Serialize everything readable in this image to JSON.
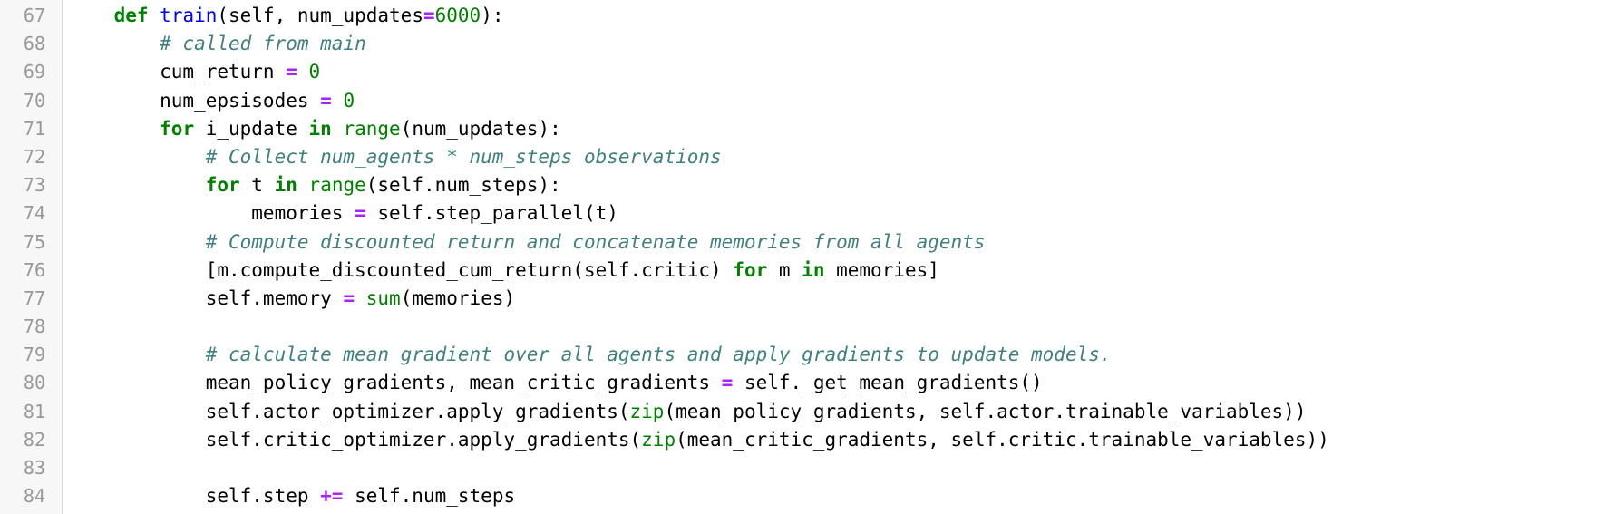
{
  "editor": {
    "lines": [
      {
        "n": "67",
        "t": [
          [
            "",
            "    "
          ],
          [
            "kw",
            "def"
          ],
          [
            "",
            " "
          ],
          [
            "fn",
            "train"
          ],
          [
            "",
            "(self, num_updates"
          ],
          [
            "op",
            "="
          ],
          [
            "num",
            "6000"
          ],
          [
            "",
            "):"
          ]
        ]
      },
      {
        "n": "68",
        "t": [
          [
            "",
            "        "
          ],
          [
            "cm",
            "# called from main"
          ]
        ]
      },
      {
        "n": "69",
        "t": [
          [
            "",
            "        cum_return "
          ],
          [
            "op",
            "="
          ],
          [
            "",
            " "
          ],
          [
            "num",
            "0"
          ]
        ]
      },
      {
        "n": "70",
        "t": [
          [
            "",
            "        num_epsisodes "
          ],
          [
            "op",
            "="
          ],
          [
            "",
            " "
          ],
          [
            "num",
            "0"
          ]
        ]
      },
      {
        "n": "71",
        "t": [
          [
            "",
            "        "
          ],
          [
            "kw",
            "for"
          ],
          [
            "",
            " i_update "
          ],
          [
            "kw",
            "in"
          ],
          [
            "",
            " "
          ],
          [
            "bi",
            "range"
          ],
          [
            "",
            "(num_updates):"
          ]
        ]
      },
      {
        "n": "72",
        "t": [
          [
            "",
            "            "
          ],
          [
            "cm",
            "# Collect num_agents * num_steps observations"
          ]
        ]
      },
      {
        "n": "73",
        "t": [
          [
            "",
            "            "
          ],
          [
            "kw",
            "for"
          ],
          [
            "",
            " t "
          ],
          [
            "kw",
            "in"
          ],
          [
            "",
            " "
          ],
          [
            "bi",
            "range"
          ],
          [
            "",
            "(self.num_steps):"
          ]
        ]
      },
      {
        "n": "74",
        "t": [
          [
            "",
            "                memories "
          ],
          [
            "op",
            "="
          ],
          [
            "",
            " self.step_parallel(t)"
          ]
        ]
      },
      {
        "n": "75",
        "t": [
          [
            "",
            "            "
          ],
          [
            "cm",
            "# Compute discounted return and concatenate memories from all agents"
          ]
        ]
      },
      {
        "n": "76",
        "t": [
          [
            "",
            "            [m.compute_discounted_cum_return(self.critic) "
          ],
          [
            "kw",
            "for"
          ],
          [
            "",
            " m "
          ],
          [
            "kw",
            "in"
          ],
          [
            "",
            " memories]"
          ]
        ]
      },
      {
        "n": "77",
        "t": [
          [
            "",
            "            self.memory "
          ],
          [
            "op",
            "="
          ],
          [
            "",
            " "
          ],
          [
            "bi",
            "sum"
          ],
          [
            "",
            "(memories)"
          ]
        ]
      },
      {
        "n": "78",
        "t": []
      },
      {
        "n": "79",
        "t": [
          [
            "",
            "            "
          ],
          [
            "cm",
            "# calculate mean gradient over all agents and apply gradients to update models."
          ]
        ]
      },
      {
        "n": "80",
        "t": [
          [
            "",
            "            mean_policy_gradients, mean_critic_gradients "
          ],
          [
            "op",
            "="
          ],
          [
            "",
            " self._get_mean_gradients()"
          ]
        ]
      },
      {
        "n": "81",
        "t": [
          [
            "",
            "            self.actor_optimizer.apply_gradients("
          ],
          [
            "bi",
            "zip"
          ],
          [
            "",
            "(mean_policy_gradients, self.actor.trainable_variables))"
          ]
        ]
      },
      {
        "n": "82",
        "t": [
          [
            "",
            "            self.critic_optimizer.apply_gradients("
          ],
          [
            "bi",
            "zip"
          ],
          [
            "",
            "(mean_critic_gradients, self.critic.trainable_variables))"
          ]
        ]
      },
      {
        "n": "83",
        "t": []
      },
      {
        "n": "84",
        "t": [
          [
            "",
            "            self.step "
          ],
          [
            "op",
            "+="
          ],
          [
            "",
            " self.num_steps"
          ]
        ]
      }
    ]
  },
  "colors": {
    "keyword": "#008000",
    "function_name": "#0000ff",
    "operator": "#aa22ff",
    "number": "#008000",
    "builtin": "#008000",
    "comment": "#408080",
    "line_number": "#999999",
    "gutter_bg": "#f7f7f7"
  }
}
